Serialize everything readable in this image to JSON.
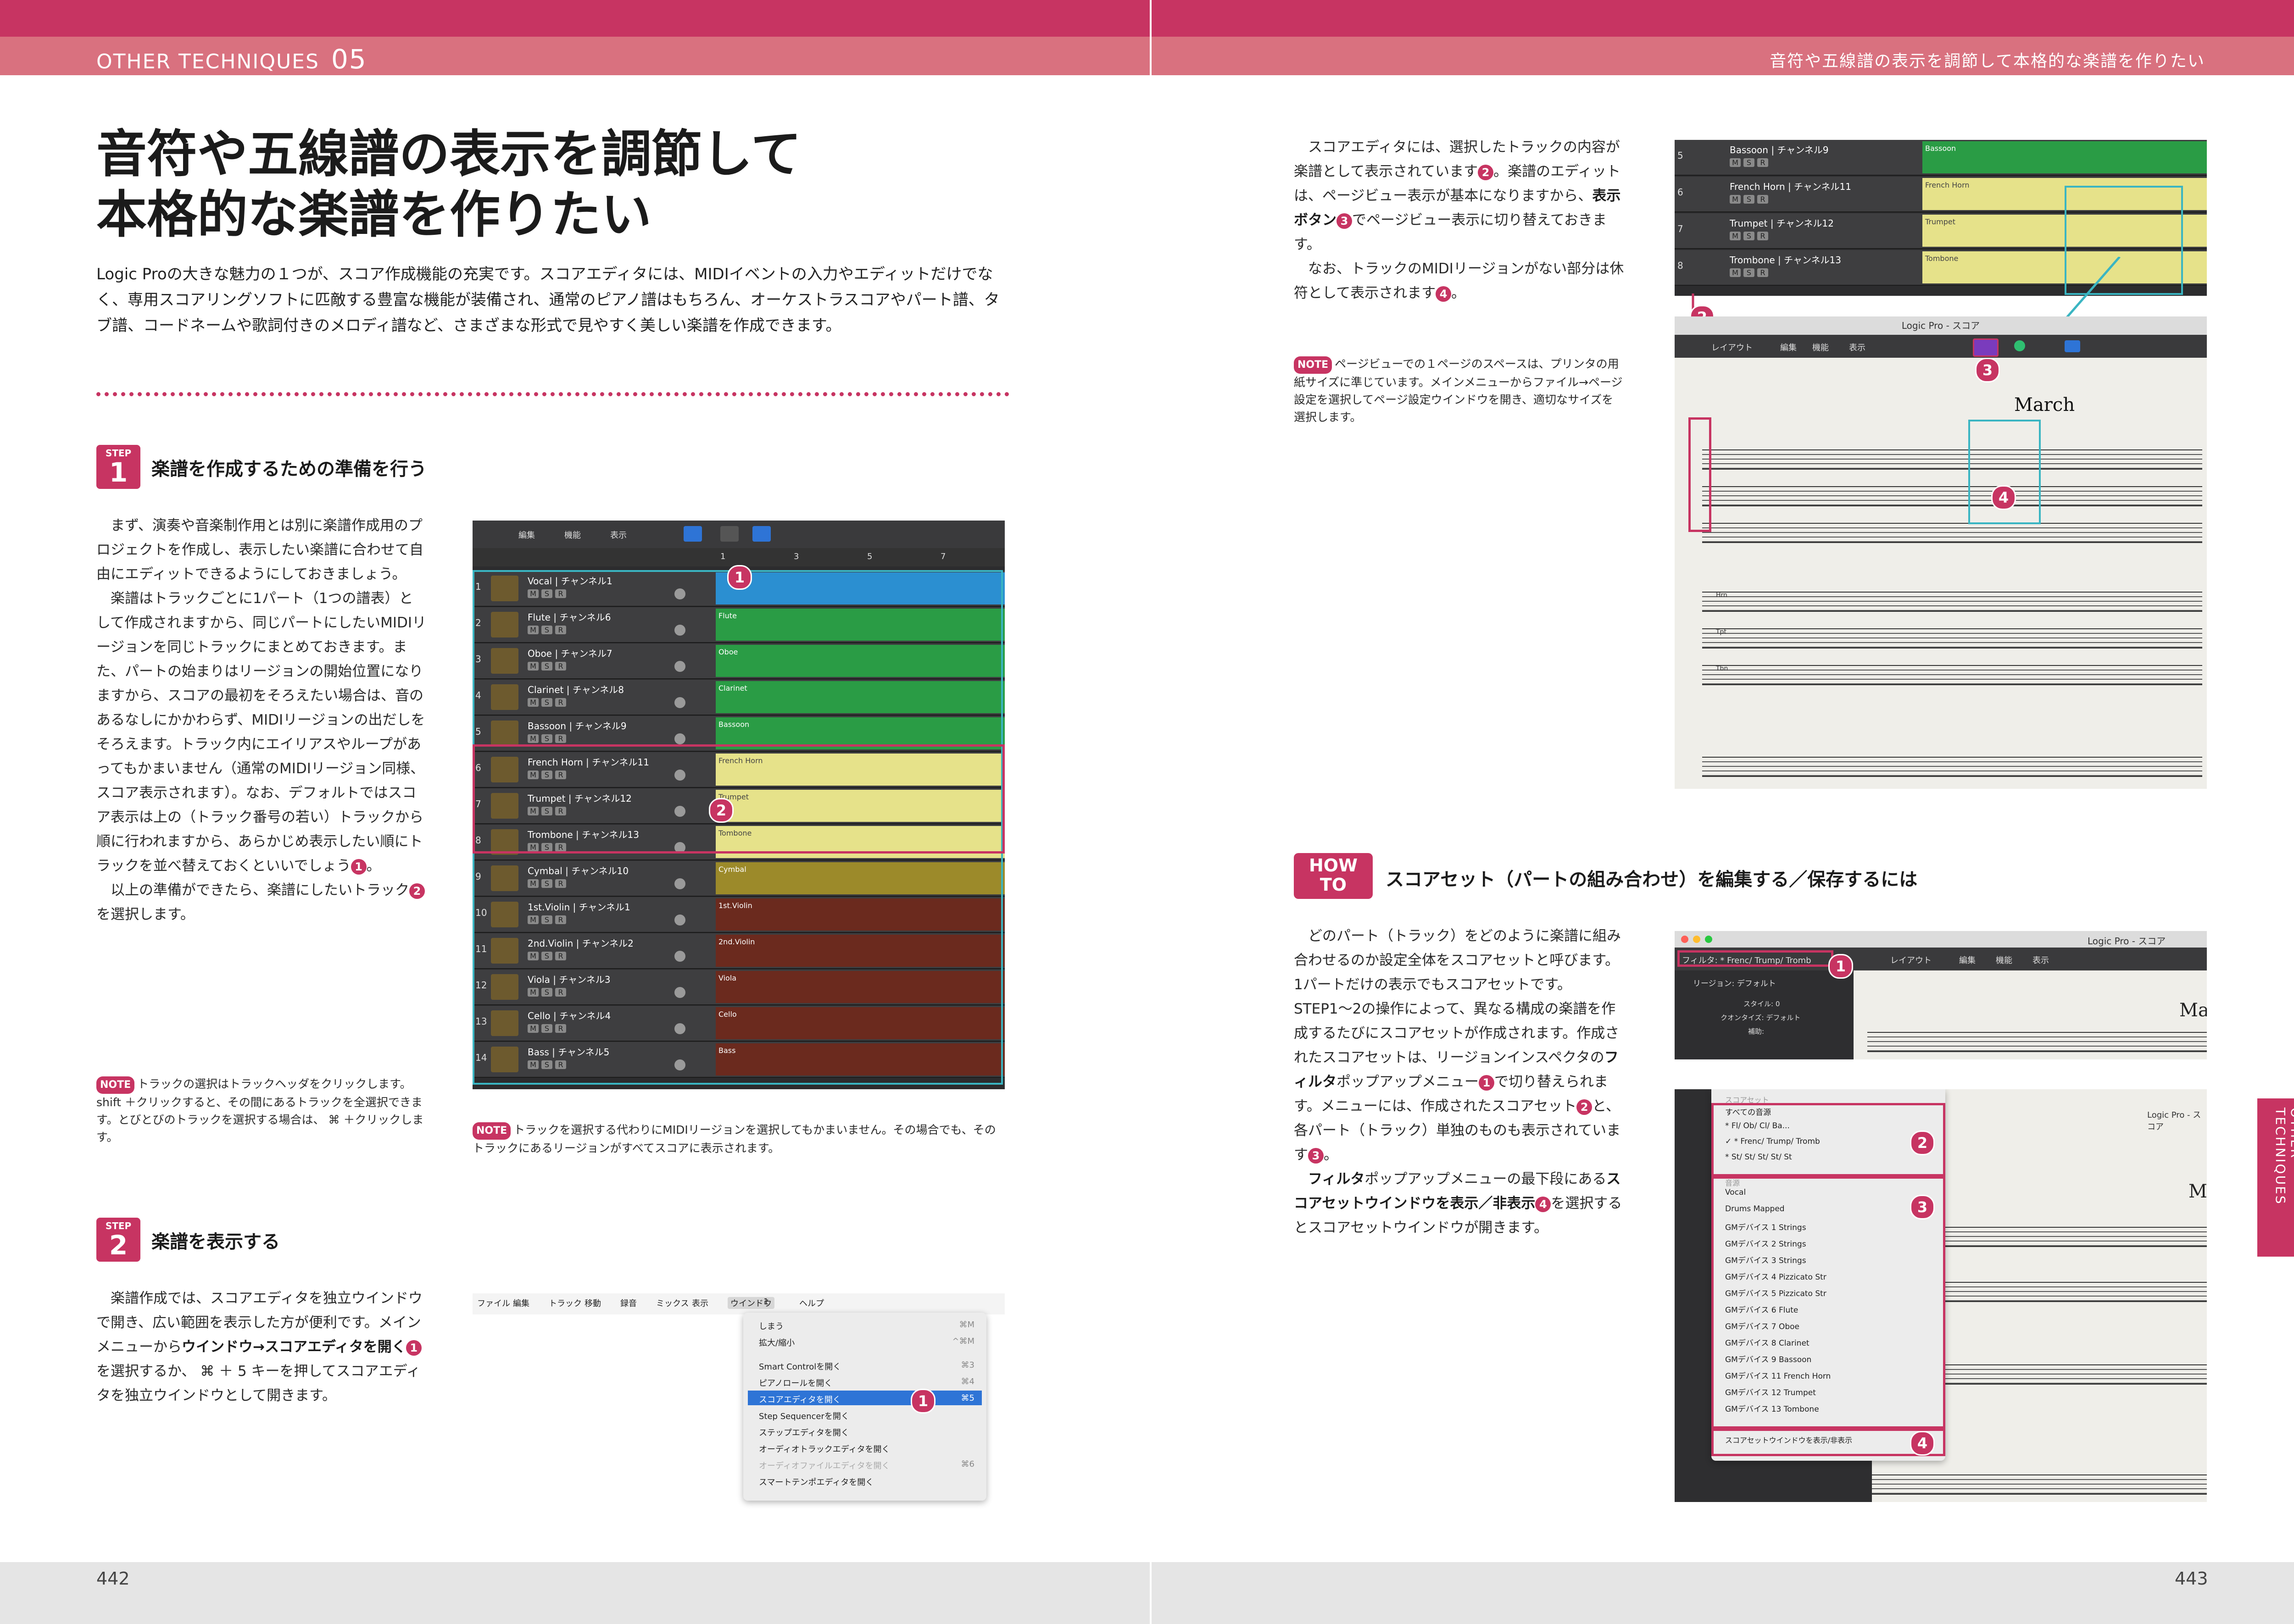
{
  "header": {
    "left_label": "OTHER TECHNIQUES",
    "left_number": "05",
    "right_label": "音符や五線譜の表示を調節して本格的な楽譜を作りたい"
  },
  "title": {
    "line1": "音符や五線譜の表示を調節して",
    "line2": "本格的な楽譜を作りたい"
  },
  "intro": "Logic Proの大きな魅力の１つが、スコア作成機能の充実です。スコアエディタには、MIDIイベントの入力やエディットだけでなく、専用スコアリングソフトに匹敵する豊富な機能が装備され、通常のピアノ譜はもちろん、オーケストラスコアやパート譜、タブ譜、コードネームや歌詞付きのメロディ譜など、さまざまな形式で見やすく美しい楽譜を作成できます。",
  "step1": {
    "badge_label": "STEP",
    "badge_number": "1",
    "title": "楽譜を作成するための準備を行う",
    "body_p1": "まず、演奏や音楽制作用とは別に楽譜作成用のプロジェクトを作成し、表示したい楽譜に合わせて自由にエディットできるようにしておきましょう。",
    "body_p2_a": "楽譜はトラックごとに1パート（1つの譜表）として作成されますから、同じパートにしたいMIDIリージョンを同じトラックにまとめておきます。また、パートの始まりはリージョンの開始位置になりますから、スコアの最初をそろえたい場合は、音のあるなしにかかわらず、MIDIリージョンの出だしをそろえます。トラック内にエイリアスやループがあってもかまいません（通常のMIDIリージョン同様、スコア表示されます）。なお、デフォルトではスコア表示は上の（トラック番号の若い）トラックから順に行われますから、あらかじめ表示したい順にトラックを並べ替えておくといいでしょう",
    "body_p2_b": "。",
    "body_p3_a": "以上の準備ができたら、楽譜にしたいトラック",
    "body_p3_b": "を選択します。",
    "note_tag": "NOTE",
    "note_text": "トラックの選択はトラックヘッダをクリックします。 shift ＋クリックすると、その間にあるトラックを全選択できます。とびとびのトラックを選択する場合は、 ⌘ ＋クリックします。",
    "screenshot_note": "トラックを選択する代わりにMIDIリージョンを選択してもかまいません。その場合でも、そのトラックにあるリージョンがすべてスコアに表示されます。"
  },
  "tracks": [
    {
      "num": "1",
      "name": "Vocal",
      "channel": "チャンネル1",
      "region": "",
      "color": "#2b8fd1"
    },
    {
      "num": "2",
      "name": "Flute",
      "channel": "チャンネル6",
      "region": "Flute",
      "color": "#2a9c45"
    },
    {
      "num": "3",
      "name": "Oboe",
      "channel": "チャンネル7",
      "region": "Oboe",
      "color": "#2a9c45"
    },
    {
      "num": "4",
      "name": "Clarinet",
      "channel": "チャンネル8",
      "region": "Clarinet",
      "color": "#2a9c45"
    },
    {
      "num": "5",
      "name": "Bassoon",
      "channel": "チャンネル9",
      "region": "Bassoon",
      "color": "#2a9c45"
    },
    {
      "num": "6",
      "name": "French Horn",
      "channel": "チャンネル11",
      "region": "French Horn",
      "color": "#e6e28a"
    },
    {
      "num": "7",
      "name": "Trumpet",
      "channel": "チャンネル12",
      "region": "Trumpet",
      "color": "#e6e28a"
    },
    {
      "num": "8",
      "name": "Trombone",
      "channel": "チャンネル13",
      "region": "Tombone",
      "color": "#e6e28a"
    },
    {
      "num": "9",
      "name": "Cymbal",
      "channel": "チャンネル10",
      "region": "Cymbal",
      "color": "#9c8a2a"
    },
    {
      "num": "10",
      "name": "1st.Violin",
      "channel": "チャンネル1",
      "region": "1st.Violin",
      "color": "#6b2a1e"
    },
    {
      "num": "11",
      "name": "2nd.Violin",
      "channel": "チャンネル2",
      "region": "2nd.Violin",
      "color": "#6b2a1e"
    },
    {
      "num": "12",
      "name": "Viola",
      "channel": "チャンネル3",
      "region": "Viola",
      "color": "#6b2a1e"
    },
    {
      "num": "13",
      "name": "Cello",
      "channel": "チャンネル4",
      "region": "Cello",
      "color": "#6b2a1e"
    },
    {
      "num": "14",
      "name": "Bass",
      "channel": "チャンネル5",
      "region": "Bass",
      "color": "#6b2a1e"
    }
  ],
  "track_buttons": {
    "m": "M",
    "s": "S",
    "r": "R"
  },
  "editor_toolbar": {
    "edit": "編集",
    "function": "機能",
    "view": "表示"
  },
  "ruler": {
    "m1": "1",
    "m3": "3",
    "m5": "5",
    "m7": "7"
  },
  "step2": {
    "badge_label": "STEP",
    "badge_number": "2",
    "title": "楽譜を表示する",
    "body_a": "楽譜作成では、スコアエディタを独立ウインドウで開き、広い範囲を表示した方が便利です。メインメニューから",
    "body_em1": "ウインドウ→スコアエディタを開く",
    "body_b": "を選択するか、 ⌘ ＋ 5 キーを押してスコアエディタを独立ウインドウとして開きます。"
  },
  "menubar": [
    "ファイル",
    "編集",
    "トラック",
    "移動",
    "録音",
    "ミックス",
    "表示",
    "ウインドウ",
    "1",
    "ヘルプ"
  ],
  "window_menu": [
    {
      "label": "しまう",
      "key": "⌘M"
    },
    {
      "label": "拡大/縮小",
      "key": "^⌘M"
    },
    {
      "label": "Smart Controlを開く",
      "key": "⌘3"
    },
    {
      "label": "ピアノロールを開く",
      "key": "⌘4"
    },
    {
      "label": "スコアエディタを開く",
      "key": "⌘5"
    },
    {
      "label": "Step Sequencerを開く",
      "key": ""
    },
    {
      "label": "ステップエディタを開く",
      "key": ""
    },
    {
      "label": "オーディオトラックエディタを開く",
      "key": ""
    },
    {
      "label": "オーディオファイルエディタを開く",
      "key": "⌘6"
    },
    {
      "label": "スマートテンポエディタを開く",
      "key": ""
    }
  ],
  "right_top": {
    "p1_a": "スコアエディタには、選択したトラックの内容が楽譜として表示されています",
    "p1_b": "。楽譜のエディットは、ページビュー表示が基本になりますから、",
    "p1_em": "表示ボタン",
    "p1_c": "でページビュー表示に切り替えておきます。",
    "p2_a": "なお、トラックのMIDIリージョンがない部分は休符として表示されます",
    "p2_b": "。",
    "note_tag": "NOTE",
    "note_text": "ページビューでの１ページのスペースは、プリンタの用紙サイズに準じています。メインメニューからファイル→ページ設定を選択してページ設定ウインドウを開き、適切なサイズを選択します。"
  },
  "score_window": {
    "title": "Logic Pro - スコア",
    "layout": "レイアウト",
    "edit": "編集",
    "function": "機能",
    "view": "表示",
    "piece_title": "March",
    "staff_labels": [
      "Hrn",
      "Tpt",
      "Tbn"
    ]
  },
  "howto": {
    "tag_line1": "HOW",
    "tag_line2": "TO",
    "title": "スコアセット（パートの組み合わせ）を編集する／保存するには",
    "p1_a": "どのパート（トラック）をどのように楽譜に組み合わせるのか設定全体をスコアセットと呼びます。1パートだけの表示でもスコアセットです。STEP1〜2の操作によって、異なる構成の楽譜を作成するたびにスコアセットが作成されます。作成されたスコアセットは、リージョンインスペクタの",
    "p1_em": "フィルタ",
    "p1_b": "ポップアップメニュー",
    "p1_c": "で切り替えられます。メニューには、作成されたスコアセット",
    "p1_d": "と、各パート（トラック）単独のものも表示されています",
    "p1_e": "。",
    "p2_em1": "フィルタ",
    "p2_a": "ポップアップメニューの最下段にある",
    "p2_em2": "スコアセットウインドウを表示／非表示",
    "p2_b": "を選択するとスコアセットウインドウが開きます。"
  },
  "filter_window": {
    "title": "Logic Pro - スコア",
    "filter_label": "フィルタ: * Frenc/ Trump/ Tromb",
    "layout": "レイアウト",
    "edit": "編集",
    "function": "機能",
    "view": "表示",
    "region_label": "リージョン: デフォルト",
    "style": "スタイル: 0",
    "quantize": "クオンタイズ: デフォルト",
    "other": "補助:"
  },
  "filter_menu": {
    "header1": "スコアセット",
    "items1": [
      "すべての音源",
      "* Fl/ Ob/ Cl/ Ba...",
      "✓ * Frenc/ Trump/ Tromb",
      "* St/ St/ St/ St/ St"
    ],
    "header2": "音源",
    "items2": [
      "Vocal",
      "Drums Mapped",
      "GMデバイス 1   Strings",
      "GMデバイス 2   Strings",
      "GMデバイス 3   Strings",
      "GMデバイス 4   Pizzicato Str",
      "GMデバイス 5   Pizzicato Str",
      "GMデバイス 6   Flute",
      "GMデバイス 7   Oboe",
      "GMデバイス 8   Clarinet",
      "GMデバイス 9   Bassoon",
      "GMデバイス 11   French Horn",
      "GMデバイス 12   Trumpet",
      "GMデバイス 13   Tombone"
    ],
    "footer": "スコアセットウインドウを表示/非表示"
  },
  "side_tab": "OTHER TECHNIQUES",
  "page_numbers": {
    "left": "442",
    "right": "443"
  },
  "callouts": {
    "c1": "1",
    "c2": "2",
    "c3": "3",
    "c4": "4"
  }
}
